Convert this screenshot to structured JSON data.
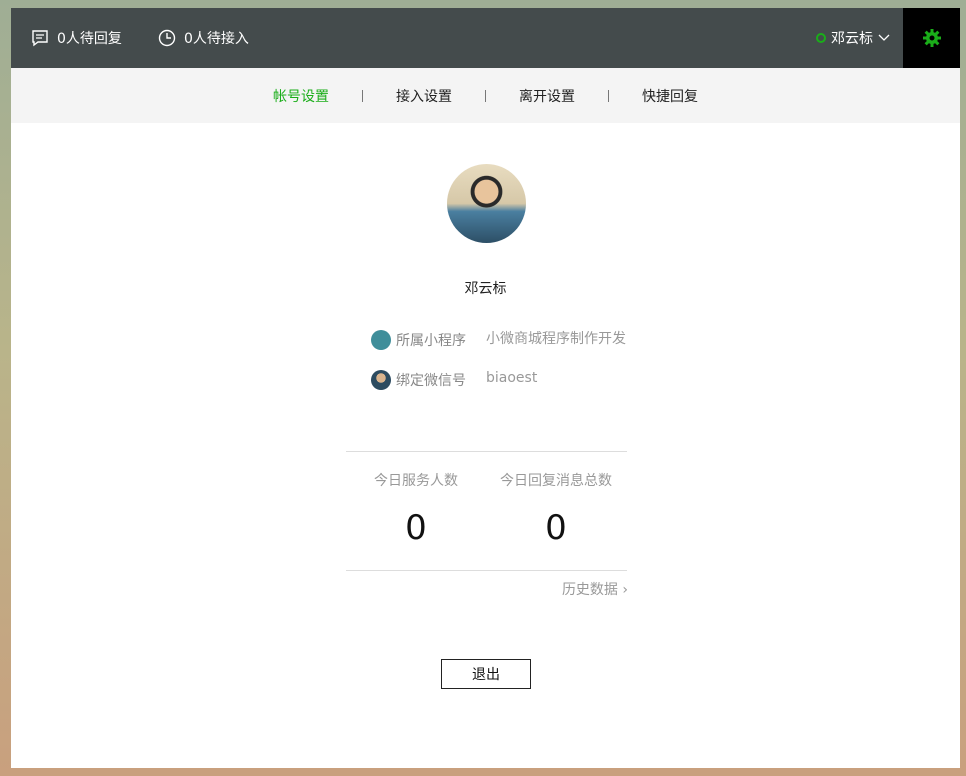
{
  "header": {
    "pending_reply": "0人待回复",
    "pending_access": "0人待接入",
    "user_name": "邓云标",
    "status_color": "#1aad19"
  },
  "tabs": [
    {
      "label": "帐号设置",
      "active": true
    },
    {
      "label": "接入设置"
    },
    {
      "label": "离开设置"
    },
    {
      "label": "快捷回复"
    }
  ],
  "profile": {
    "name": "邓云标",
    "mini_program_label": "所属小程序",
    "mini_program_value": "小微商城程序制作开发",
    "wechat_label": "绑定微信号",
    "wechat_value": "biaoest"
  },
  "stats": [
    {
      "label": "今日服务人数",
      "value": "0"
    },
    {
      "label": "今日回复消息总数",
      "value": "0"
    }
  ],
  "history_link": "历史数据",
  "logout_label": "退出"
}
